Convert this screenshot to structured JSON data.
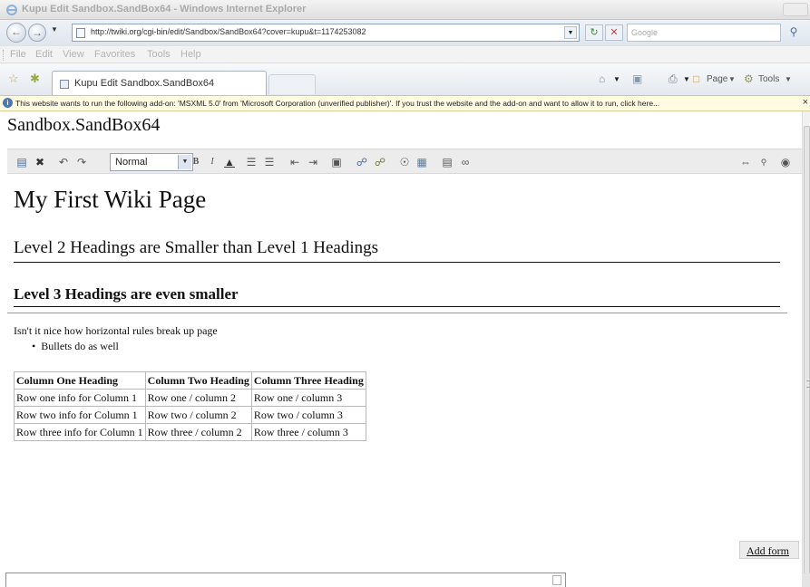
{
  "window": {
    "title": "Kupu Edit Sandbox.SandBox64 - Windows Internet Explorer"
  },
  "address_bar": {
    "url": "http://twiki.org/cgi-bin/edit/Sandbox/SandBox64?cover=kupu&t=1174253082",
    "search_placeholder": "Google"
  },
  "menu": {
    "items": [
      "File",
      "Edit",
      "View",
      "Favorites",
      "Tools",
      "Help"
    ]
  },
  "tabs": {
    "active_label": "Kupu Edit Sandbox.SandBox64"
  },
  "command_bar": {
    "page_label": "Page",
    "tools_label": "Tools"
  },
  "info_bar": {
    "message": "This website wants to run the following add-on: 'MSXML 5.0' from 'Microsoft Corporation (unverified publisher)'. If you trust the website and the add-on and want to allow it to run, click here..."
  },
  "page": {
    "title": "Sandbox.SandBox64"
  },
  "editor_toolbar": {
    "style_value": "Normal",
    "bold_label": "B",
    "italic_label": "I"
  },
  "document": {
    "h1": "My First Wiki Page",
    "h2": "Level 2 Headings are Smaller than Level 1 Headings",
    "h3": "Level 3 Headings are even smaller",
    "paragraph": "Isn't it nice how horizontal rules break up page",
    "bullets": [
      "Bullets do as well"
    ],
    "table": {
      "headers": [
        "Column One Heading",
        "Column Two Heading",
        "Column Three Heading"
      ],
      "rows": [
        [
          "Row one info for Column 1",
          "Row one / column 2",
          "Row one / column 3"
        ],
        [
          "Row two info for Column 1",
          "Row two / column 2",
          "Row two / column 3"
        ],
        [
          "Row three info for Column 1",
          "Row three / column 2",
          "Row three / column 3"
        ]
      ]
    }
  },
  "add_form": {
    "label": "Add form"
  }
}
